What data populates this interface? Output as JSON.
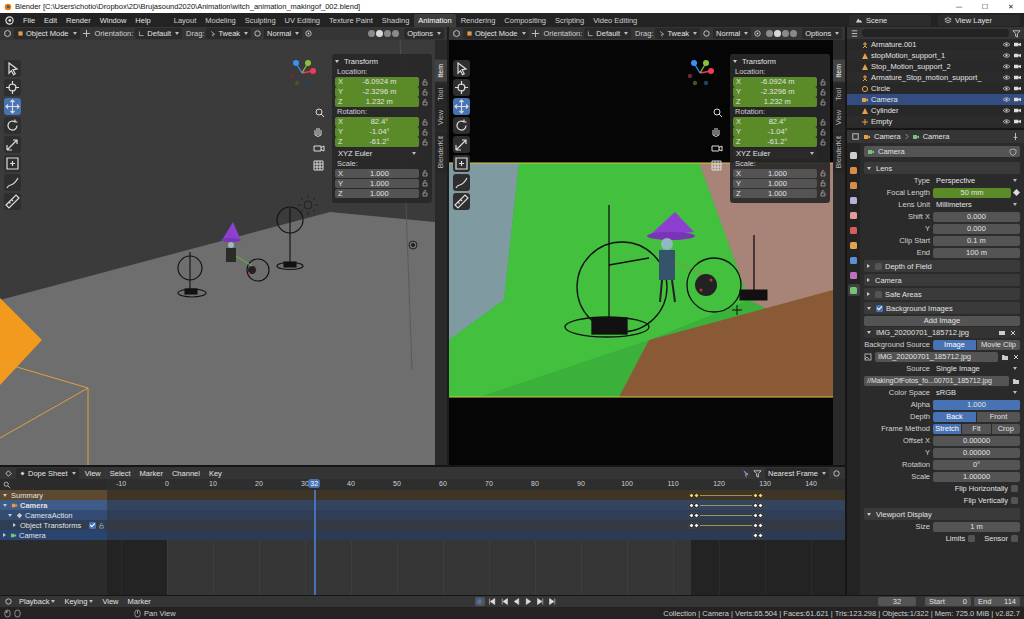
{
  "window": {
    "title": "Blender [C:\\Users\\chotio\\Dropbox\\2D\\Brujasound2020\\Animation\\witch_animation_makingof_002.blend]",
    "controls": [
      "—",
      "☐",
      "✕"
    ]
  },
  "menu": [
    "File",
    "Edit",
    "Render",
    "Window",
    "Help"
  ],
  "workspaces": [
    {
      "label": "Layout",
      "selected": false
    },
    {
      "label": "Modeling",
      "selected": false
    },
    {
      "label": "Sculpting",
      "selected": false
    },
    {
      "label": "UV Editing",
      "selected": false
    },
    {
      "label": "Texture Paint",
      "selected": false
    },
    {
      "label": "Shading",
      "selected": false
    },
    {
      "label": "Animation",
      "selected": true
    },
    {
      "label": "Rendering",
      "selected": false
    },
    {
      "label": "Compositing",
      "selected": false
    },
    {
      "label": "Scripting",
      "selected": false
    },
    {
      "label": "Video Editing",
      "selected": false
    }
  ],
  "scene": "Scene",
  "view_layer": "View Layer",
  "viewports": [
    {
      "kind": "scene",
      "header": {
        "mode": "Object Mode",
        "orientation_label": "Orientation:",
        "orientation": "Default",
        "drag_label": "Drag:",
        "drag": "Tweak",
        "pivot": "Normal",
        "options": "Options"
      },
      "tools": [
        {
          "selected": false
        },
        {
          "selected": false
        },
        {
          "selected": true
        },
        {
          "selected": false
        },
        {
          "selected": false
        },
        {
          "selected": false
        },
        {
          "selected": false
        },
        {
          "selected": false
        }
      ],
      "transform": {
        "title": "Transform",
        "location": {
          "label": "Location:",
          "fields": [
            {
              "axis": "X",
              "value": "-6.0924 m",
              "keyed": true
            },
            {
              "axis": "Y",
              "value": "-2.3296 m",
              "keyed": true
            },
            {
              "axis": "Z",
              "value": "1.232 m",
              "keyed": true
            }
          ]
        },
        "rotation": {
          "label": "Rotation:",
          "fields": [
            {
              "axis": "X",
              "value": "82.4°",
              "keyed": true
            },
            {
              "axis": "Y",
              "value": "-1.04°",
              "keyed": true
            },
            {
              "axis": "Z",
              "value": "-61.2°",
              "keyed": true
            }
          ]
        },
        "rotation_mode": "XYZ Euler",
        "scale": {
          "label": "Scale:",
          "fields": [
            {
              "axis": "X",
              "value": "1.000",
              "keyed": false
            },
            {
              "axis": "Y",
              "value": "1.000",
              "keyed": false
            },
            {
              "axis": "Z",
              "value": "1.000",
              "keyed": false
            }
          ]
        }
      },
      "side_tabs": [
        {
          "label": "Item",
          "selected": true
        },
        {
          "label": "Tool",
          "selected": false
        },
        {
          "label": "View",
          "selected": false
        },
        {
          "label": "BlenderKit",
          "selected": false
        }
      ]
    },
    {
      "kind": "camera",
      "header": {
        "mode": "Object Mode",
        "orientation_label": "Orientation:",
        "orientation": "Default",
        "drag_label": "Drag:",
        "drag": "Tweak",
        "pivot": "Normal",
        "options": "Options"
      },
      "tools": [
        {
          "selected": false
        },
        {
          "selected": false
        },
        {
          "selected": true
        },
        {
          "selected": false
        },
        {
          "selected": false
        },
        {
          "selected": false
        },
        {
          "selected": false
        },
        {
          "selected": false
        }
      ],
      "transform": {
        "title": "Transform",
        "location": {
          "label": "Location:",
          "fields": [
            {
              "axis": "X",
              "value": "-6.0924 m",
              "keyed": true
            },
            {
              "axis": "Y",
              "value": "-2.3296 m",
              "keyed": true
            },
            {
              "axis": "Z",
              "value": "1.232 m",
              "keyed": true
            }
          ]
        },
        "rotation": {
          "label": "Rotation:",
          "fields": [
            {
              "axis": "X",
              "value": "82.4°",
              "keyed": true
            },
            {
              "axis": "Y",
              "value": "-1.04°",
              "keyed": true
            },
            {
              "axis": "Z",
              "value": "-61.2°",
              "keyed": true
            }
          ]
        },
        "rotation_mode": "XYZ Euler",
        "scale": {
          "label": "Scale:",
          "fields": [
            {
              "axis": "X",
              "value": "1.000",
              "keyed": false
            },
            {
              "axis": "Y",
              "value": "1.000",
              "keyed": false
            },
            {
              "axis": "Z",
              "value": "1.000",
              "keyed": false
            }
          ]
        }
      },
      "side_tabs": [
        {
          "label": "Item",
          "selected": true
        },
        {
          "label": "Tool",
          "selected": false
        },
        {
          "label": "View",
          "selected": false
        },
        {
          "label": "BlenderKit",
          "selected": false
        }
      ]
    }
  ],
  "dopesheet": {
    "editor": "Dope Sheet",
    "menus": [
      "View",
      "Select",
      "Marker",
      "Channel",
      "Key"
    ],
    "snap": "Nearest Frame",
    "ruler": [
      "-10",
      "0",
      "10",
      "20",
      "30",
      "40",
      "50",
      "60",
      "70",
      "80",
      "90",
      "100",
      "110",
      "120",
      "130",
      "140"
    ],
    "current_frame": "32",
    "channels": [
      {
        "label": "Summary",
        "kind": "summary",
        "expanded": true,
        "keys": [
          114,
          115,
          128,
          129
        ]
      },
      {
        "label": "Camera",
        "kind": "object",
        "expanded": true,
        "keys": [
          114,
          115,
          128,
          129
        ]
      },
      {
        "label": "CameraAction",
        "kind": "action",
        "expanded": true,
        "keys": [
          114,
          115,
          128,
          129
        ]
      },
      {
        "label": "Object Transforms",
        "kind": "group",
        "expanded": false,
        "keys": [
          114,
          115,
          128,
          129
        ]
      },
      {
        "label": "Camera",
        "kind": "data",
        "expanded": false,
        "keys": [
          128,
          129
        ]
      }
    ]
  },
  "playback": {
    "menus": [
      {
        "label": "Playback",
        "kind": "dropdown"
      },
      {
        "label": "Keying",
        "kind": "dropdown"
      },
      {
        "label": "View",
        "kind": "menu"
      },
      {
        "label": "Marker",
        "kind": "menu"
      }
    ],
    "frame": "32",
    "start": {
      "label": "Start",
      "value": "0"
    },
    "end": {
      "label": "End",
      "value": "114"
    }
  },
  "outliner": {
    "items": [
      {
        "label": "Armature.001",
        "kind": "armature",
        "selected": false
      },
      {
        "label": "stopMotion_support_1",
        "kind": "mesh",
        "selected": false
      },
      {
        "label": "Stop_Motion_support_2",
        "kind": "mesh",
        "selected": false
      },
      {
        "label": "Armature_Stop_motion_support_",
        "kind": "armature",
        "selected": false
      },
      {
        "label": "Circle",
        "kind": "curve",
        "selected": false
      },
      {
        "label": "Camera",
        "kind": "camera",
        "selected": true
      },
      {
        "label": "Cylinder",
        "kind": "mesh",
        "selected": false
      },
      {
        "label": "Empty",
        "kind": "empty",
        "selected": false
      }
    ]
  },
  "properties": {
    "breadcrumb": [
      "Camera",
      "Camera"
    ],
    "data_name": "Camera",
    "tabs": [
      {
        "selected": false
      },
      {
        "selected": false
      },
      {
        "selected": false
      },
      {
        "selected": false
      },
      {
        "selected": false
      },
      {
        "selected": false
      },
      {
        "selected": false
      },
      {
        "selected": false
      },
      {
        "selected": false
      },
      {
        "selected": true
      }
    ],
    "rows": [
      {
        "kind": "section",
        "label": "Lens",
        "expanded": true
      },
      {
        "kind": "dropdown",
        "label": "Type",
        "value": "Perspective"
      },
      {
        "kind": "number",
        "label": "Focal Length",
        "value": "50 mm",
        "keyed": true
      },
      {
        "kind": "dropdown",
        "label": "Lens Unit",
        "value": "Millimeters"
      },
      {
        "kind": "number",
        "label": "Shift X",
        "value": "0.000",
        "keyed": false
      },
      {
        "kind": "number",
        "label": "Y",
        "value": "0.000",
        "keyed": false
      },
      {
        "kind": "number",
        "label": "Clip Start",
        "value": "0.1 m",
        "keyed": false
      },
      {
        "kind": "number",
        "label": "End",
        "value": "100 m",
        "keyed": false
      },
      {
        "kind": "section",
        "label": "Depth of Field",
        "expanded": false,
        "checked": false
      },
      {
        "kind": "section",
        "label": "Camera",
        "expanded": false
      },
      {
        "kind": "section",
        "label": "Safe Areas",
        "expanded": false,
        "checked": false
      },
      {
        "kind": "section",
        "label": "Background Images",
        "expanded": true,
        "checked": true
      },
      {
        "kind": "button",
        "label": "Add Image"
      },
      {
        "kind": "image-header",
        "label": "IMG_20200701_185712.jpg",
        "expanded": true
      },
      {
        "kind": "toggle",
        "label": "Background Source",
        "options": [
          {
            "label": "Image",
            "selected": true
          },
          {
            "label": "Movie Clip",
            "selected": false
          }
        ]
      },
      {
        "kind": "file",
        "value": "IMG_20200701_185712.jpg"
      },
      {
        "kind": "dropdown",
        "label": "Source",
        "value": "Single Image"
      },
      {
        "kind": "path",
        "value": "//MakingOfFotos_fo...00701_185712.jpg"
      },
      {
        "kind": "dropdown",
        "label": "Color Space",
        "value": "sRGB"
      },
      {
        "kind": "slider",
        "label": "Alpha",
        "value": "1.000",
        "level": 1
      },
      {
        "kind": "toggle",
        "label": "Depth",
        "options": [
          {
            "label": "Back",
            "selected": true
          },
          {
            "label": "Front",
            "selected": false
          }
        ]
      },
      {
        "kind": "toggle",
        "label": "Frame Method",
        "options": [
          {
            "label": "Stretch",
            "selected": true
          },
          {
            "label": "Fit",
            "selected": false
          },
          {
            "label": "Crop",
            "selected": false
          }
        ]
      },
      {
        "kind": "number",
        "label": "Offset X",
        "value": "0.00000",
        "keyed": false
      },
      {
        "kind": "number",
        "label": "Y",
        "value": "0.00000",
        "keyed": false
      },
      {
        "kind": "number",
        "label": "Rotation",
        "value": "0°",
        "keyed": false
      },
      {
        "kind": "number",
        "label": "Scale",
        "value": "1.00000",
        "keyed": false
      },
      {
        "kind": "check",
        "label": "Flip Horizontally",
        "checked": false
      },
      {
        "kind": "check",
        "label": "Flip Vertically",
        "checked": false
      },
      {
        "kind": "section",
        "label": "Viewport Display",
        "expanded": true
      },
      {
        "kind": "number",
        "label": "Size",
        "value": "1 m",
        "keyed": false
      },
      {
        "kind": "checkpair",
        "items": [
          {
            "label": "Limits",
            "checked": false
          },
          {
            "label": "Sensor",
            "checked": false
          }
        ]
      }
    ]
  },
  "status_bar": {
    "hint": "Pan View",
    "stats": "Collection | Camera | Verts:65.504 | Faces:61.621 | Tris:123.298 | Objects:1/322 | Mem: 725.0 MiB | v2.82.7"
  }
}
